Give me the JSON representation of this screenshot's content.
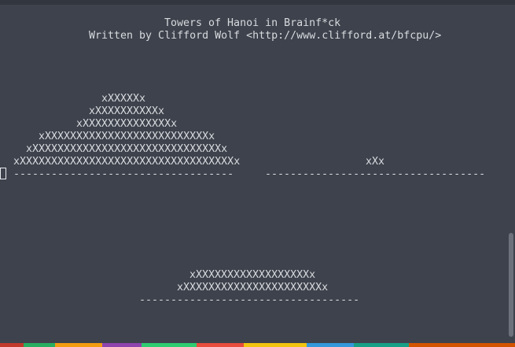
{
  "terminal": {
    "header": {
      "title": "Towers of Hanoi in Brainf*ck",
      "credit": "Written by Clifford Wolf <http://www.clifford.at/bfcpu/>"
    },
    "tower_left": {
      "disks": [
        "xXXXXXx",
        "xXXXXXXXXXXx",
        "xXXXXXXXXXXXXXXx",
        "xXXXXXXXXXXXXXXXXXXXXXXXXXXx",
        "xXXXXXXXXXXXXXXXXXXXXXXXXXXXXXXx",
        "xXXXXXXXXXXXXXXXXXXXXXXXXXXXXXXXXXXx"
      ],
      "base": "-----------------------------------"
    },
    "tower_right": {
      "disks": [
        "xXx"
      ],
      "base": "-----------------------------------"
    },
    "tower_bottom": {
      "disks": [
        "xXXXXXXXXXXXXXXXXXXx",
        "xXXXXXXXXXXXXXXXXXXXXXXx"
      ],
      "base": "-----------------------------------"
    }
  },
  "colors": {
    "background": "#3d424c",
    "text": "#d8dade",
    "scrollbar_thumb": "#6c717b"
  }
}
